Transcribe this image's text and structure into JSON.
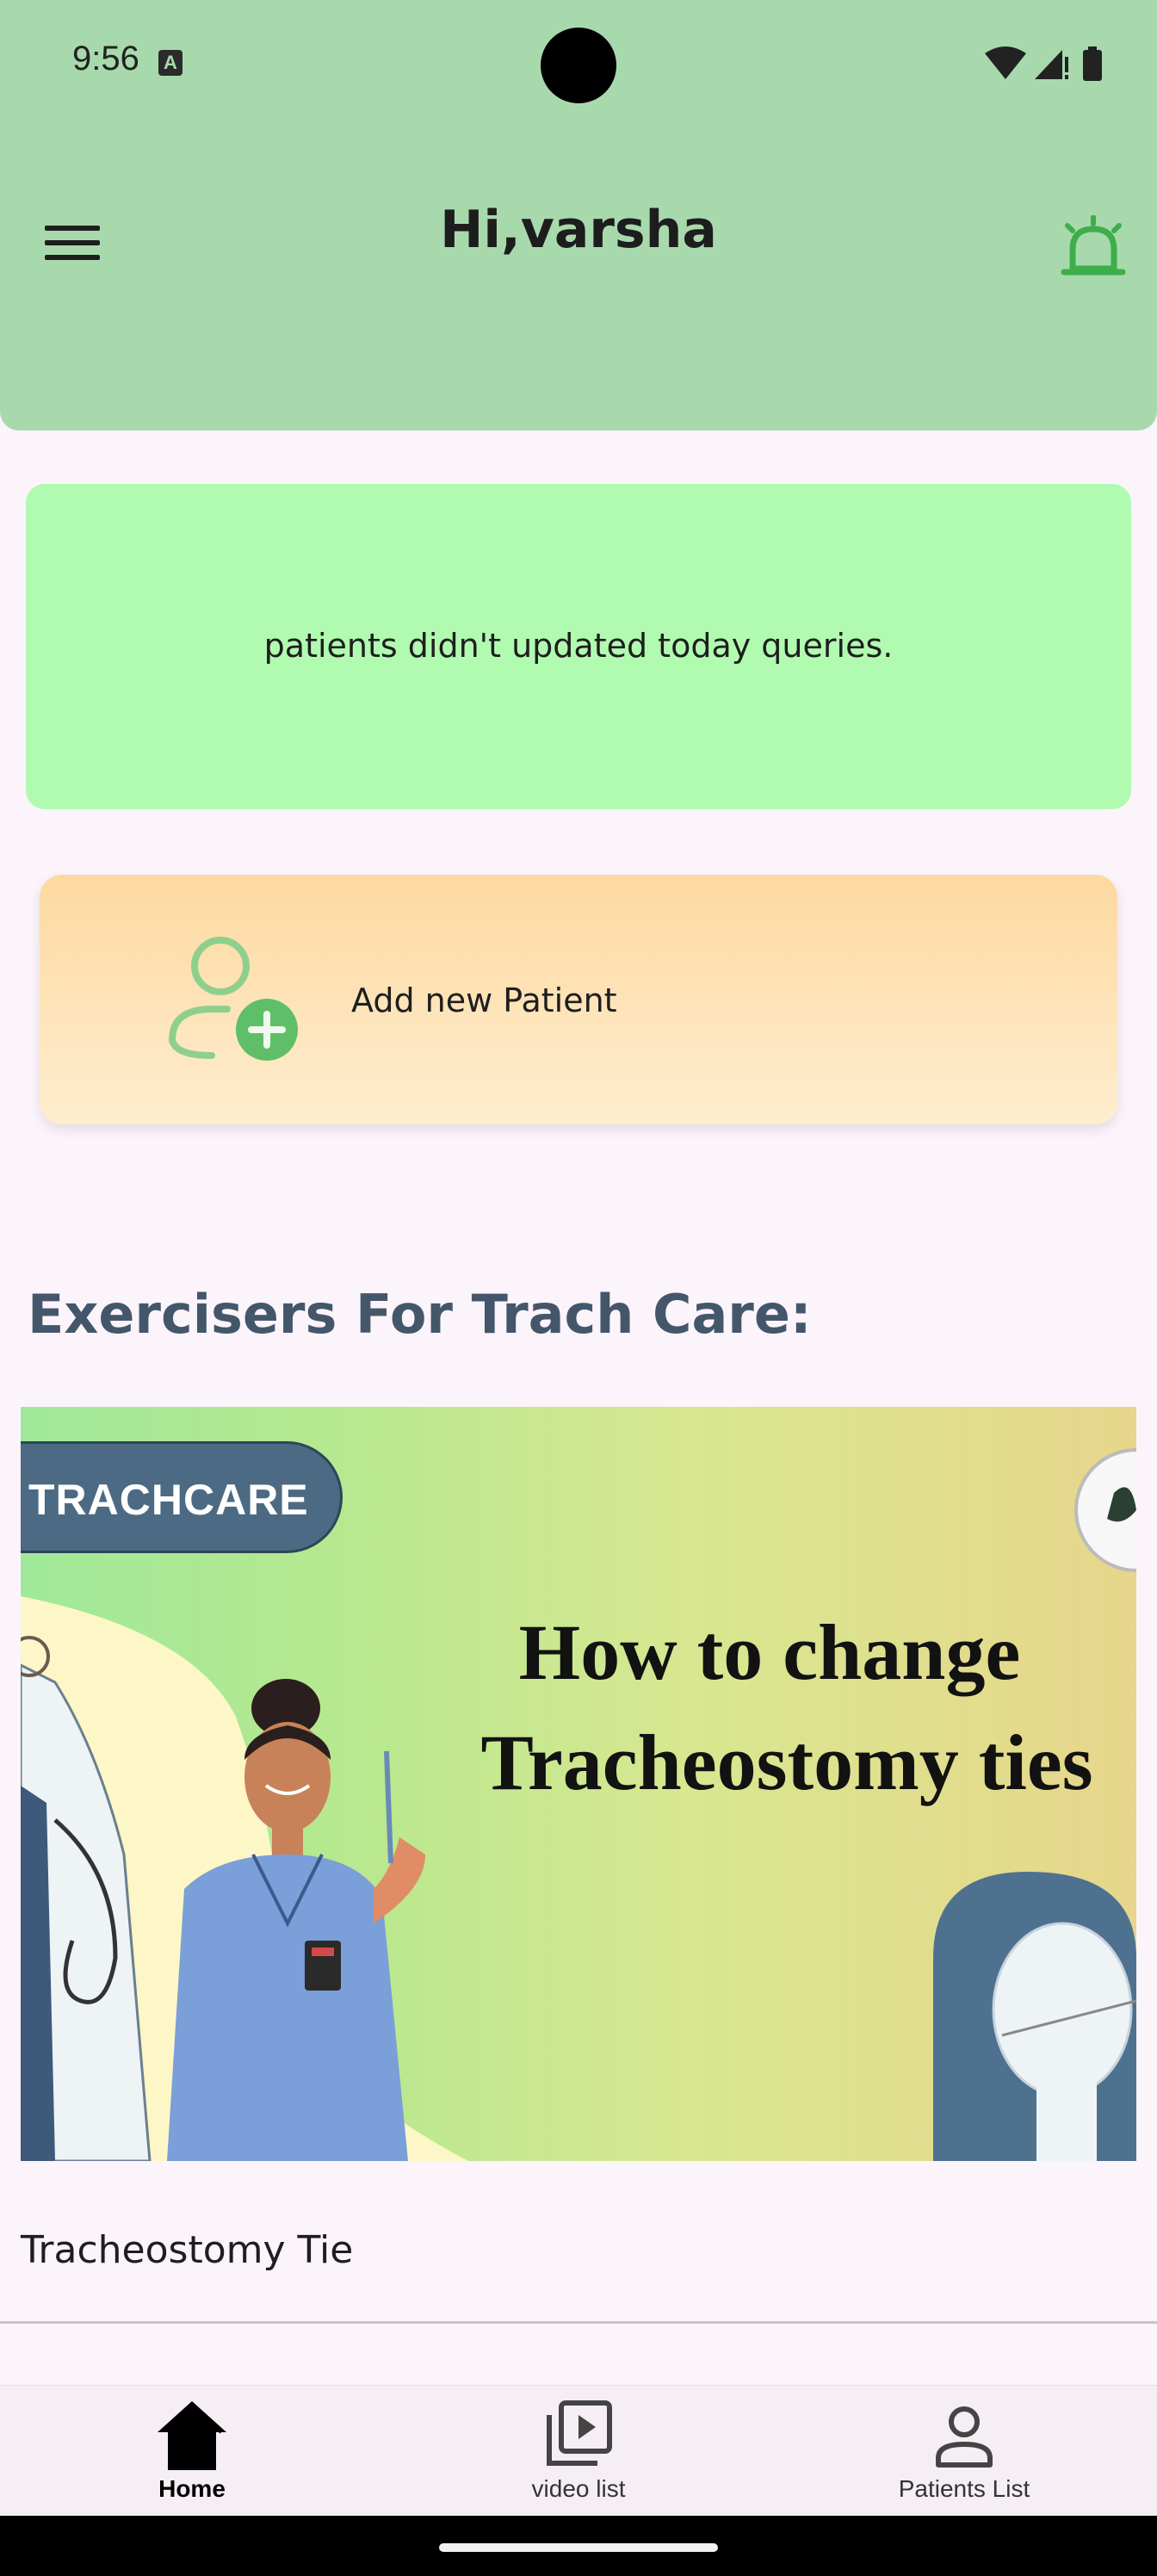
{
  "status_bar": {
    "time": "9:56",
    "notification_badge": "A"
  },
  "header": {
    "title": "Hi,varsha",
    "menu_icon": "hamburger-menu-icon",
    "alarm_icon": "alarm-bell-icon",
    "background_color": "#a8d9ad"
  },
  "alert_card": {
    "message": "patients didn't updated today queries.",
    "background_color": "#b1fbb1"
  },
  "add_patient": {
    "label": "Add new Patient",
    "icon": "add-user-icon"
  },
  "section": {
    "title": "Exercisers For Trach Care:"
  },
  "video": {
    "thumbnail_tag": "TRACHCARE",
    "thumbnail_title_line1": "How to change",
    "thumbnail_title_line2": "Tracheostomy ties",
    "title": "Tracheostomy Tie"
  },
  "bottom_nav": {
    "items": [
      {
        "label": "Home",
        "icon": "home-icon",
        "active": true
      },
      {
        "label": "video list",
        "icon": "video-library-icon",
        "active": false
      },
      {
        "label": "Patients List",
        "icon": "person-icon",
        "active": false
      }
    ]
  }
}
